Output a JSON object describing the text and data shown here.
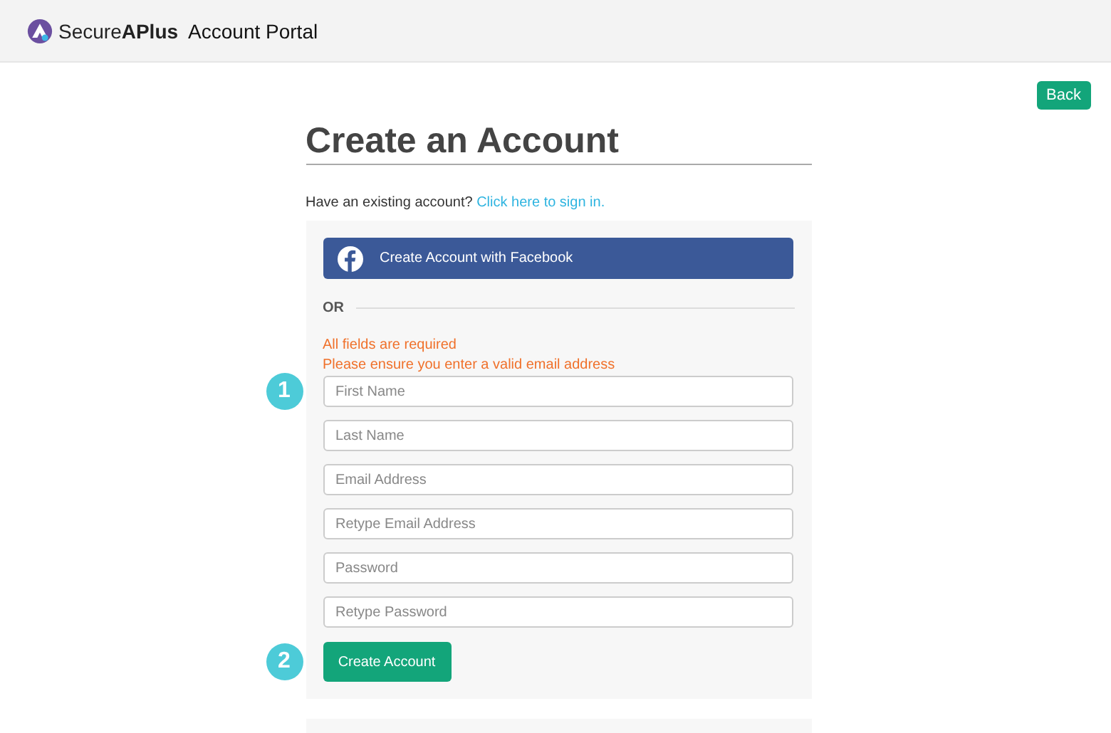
{
  "header": {
    "brand": "Secure**APlus**",
    "title": "Account Portal"
  },
  "back_button": "Back",
  "page_title": "Create an Account",
  "signin_prompt": {
    "text": "Have an existing account?",
    "link": "Click here to sign in."
  },
  "facebook_button": "Create Account with Facebook",
  "divider_label": "OR",
  "errors": [
    "All fields are required",
    "Please ensure you enter a valid email address"
  ],
  "fields": [
    {
      "placeholder": "First Name",
      "badge": "1"
    },
    {
      "placeholder": "Last Name"
    },
    {
      "placeholder": "Email Address"
    },
    {
      "placeholder": "Retype Email Address"
    },
    {
      "placeholder": "Password"
    },
    {
      "placeholder": "Retype Password"
    }
  ],
  "submit": {
    "label": "Create Account",
    "badge": "2"
  }
}
